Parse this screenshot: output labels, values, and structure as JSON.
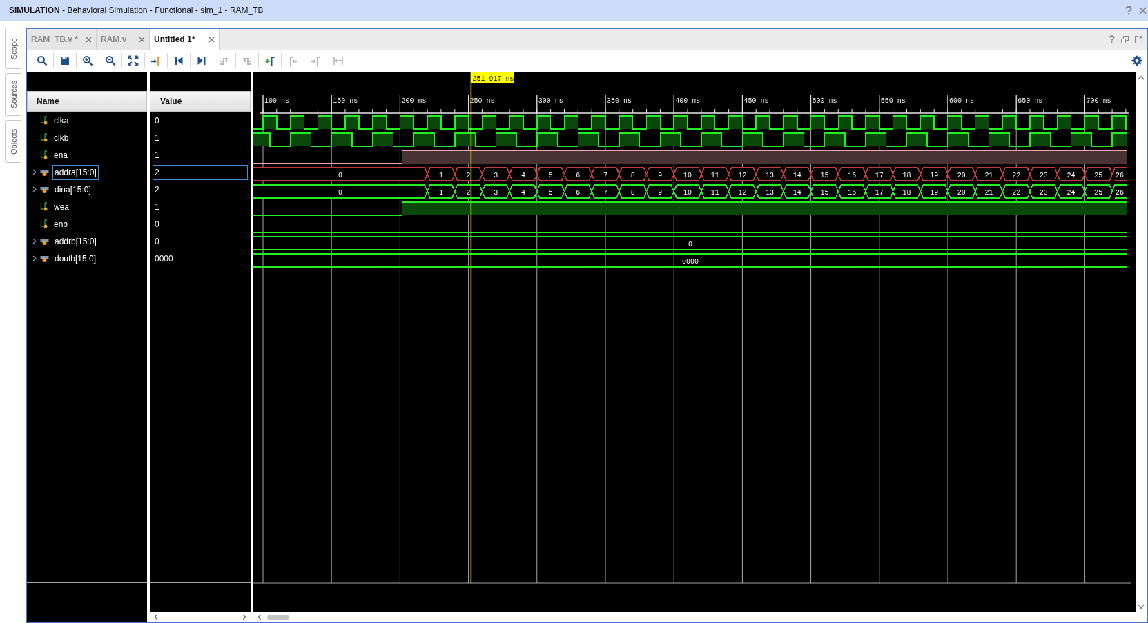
{
  "title_bar": {
    "text": "**SIMULATION** - Behavioral Simulation - Functional - sim_1 - RAM_TB"
  },
  "side_tabs": [
    {
      "label": "Scope"
    },
    {
      "label": "Sources"
    },
    {
      "label": "Objects"
    }
  ],
  "tabs": [
    {
      "label": "RAM_TB.v *",
      "selected": false
    },
    {
      "label": "RAM.v",
      "selected": false
    },
    {
      "label": "Untitled 1*",
      "selected": true
    }
  ],
  "toolbar": [
    {
      "disabled": false
    },
    {
      "disabled": false
    },
    {
      "disabled": false
    },
    {
      "disabled": false
    },
    {
      "disabled": false
    },
    {
      "disabled": false
    },
    {
      "disabled": false
    },
    {
      "disabled": false
    },
    {
      "disabled": true
    },
    {
      "disabled": true
    },
    {
      "disabled": false
    },
    {
      "disabled": true
    },
    {
      "disabled": true
    },
    {
      "disabled": true
    }
  ],
  "columns": {
    "name": "Name",
    "value": "Value"
  },
  "cursor": {
    "label": "251.917 ns"
  },
  "timeline": {
    "ticks": [
      "100 ns",
      "150 ns",
      "200 ns",
      "250 ns",
      "300 ns",
      "350 ns",
      "400 ns",
      "450 ns",
      "500 ns",
      "550 ns",
      "600 ns",
      "650 ns",
      "700 ns"
    ]
  },
  "signals": [
    {
      "name": "clka",
      "value": "0",
      "kind": "bit",
      "selected": false,
      "trace": {
        "kind": "fast_clock",
        "color": "#22ee22"
      }
    },
    {
      "name": "clkb",
      "value": "1",
      "kind": "bit",
      "selected": false,
      "trace": {
        "kind": "slow_clock",
        "color": "#22ee22"
      }
    },
    {
      "name": "ena",
      "value": "1",
      "kind": "bit",
      "selected": false,
      "trace": {
        "kind": "step",
        "color": "#f2a6ae"
      }
    },
    {
      "name": "addra[15:0]",
      "value": "2",
      "kind": "bus",
      "selected": true,
      "trace": {
        "kind": "count",
        "color": "#c83a3a",
        "labels": [
          "0",
          "1",
          "2",
          "3",
          "4",
          "5",
          "6",
          "7",
          "8",
          "9",
          "10",
          "11",
          "12",
          "13",
          "14",
          "15",
          "16",
          "17",
          "18",
          "19",
          "20",
          "21",
          "22",
          "23",
          "24",
          "25",
          "26"
        ]
      }
    },
    {
      "name": "dina[15:0]",
      "value": "2",
      "kind": "bus",
      "selected": false,
      "trace": {
        "kind": "count",
        "color": "#22ee22",
        "labels": [
          "0",
          "1",
          "2",
          "3",
          "4",
          "5",
          "6",
          "7",
          "8",
          "9",
          "10",
          "11",
          "12",
          "13",
          "14",
          "15",
          "16",
          "17",
          "18",
          "19",
          "20",
          "21",
          "22",
          "23",
          "24",
          "25",
          "26"
        ]
      }
    },
    {
      "name": "wea",
      "value": "1",
      "kind": "bit",
      "selected": false,
      "trace": {
        "kind": "step",
        "color": "#22ee22"
      }
    },
    {
      "name": "enb",
      "value": "0",
      "kind": "bit",
      "selected": false,
      "trace": {
        "kind": "low",
        "color": "#22ee22"
      }
    },
    {
      "name": "addrb[15:0]",
      "value": "0",
      "kind": "bus",
      "selected": false,
      "trace": {
        "kind": "constant",
        "color": "#22ee22",
        "label": "0"
      }
    },
    {
      "name": "doutb[15:0]",
      "value": "0000",
      "kind": "bus",
      "selected": false,
      "trace": {
        "kind": "constant",
        "color": "#22ee22",
        "label": "0000"
      }
    }
  ]
}
